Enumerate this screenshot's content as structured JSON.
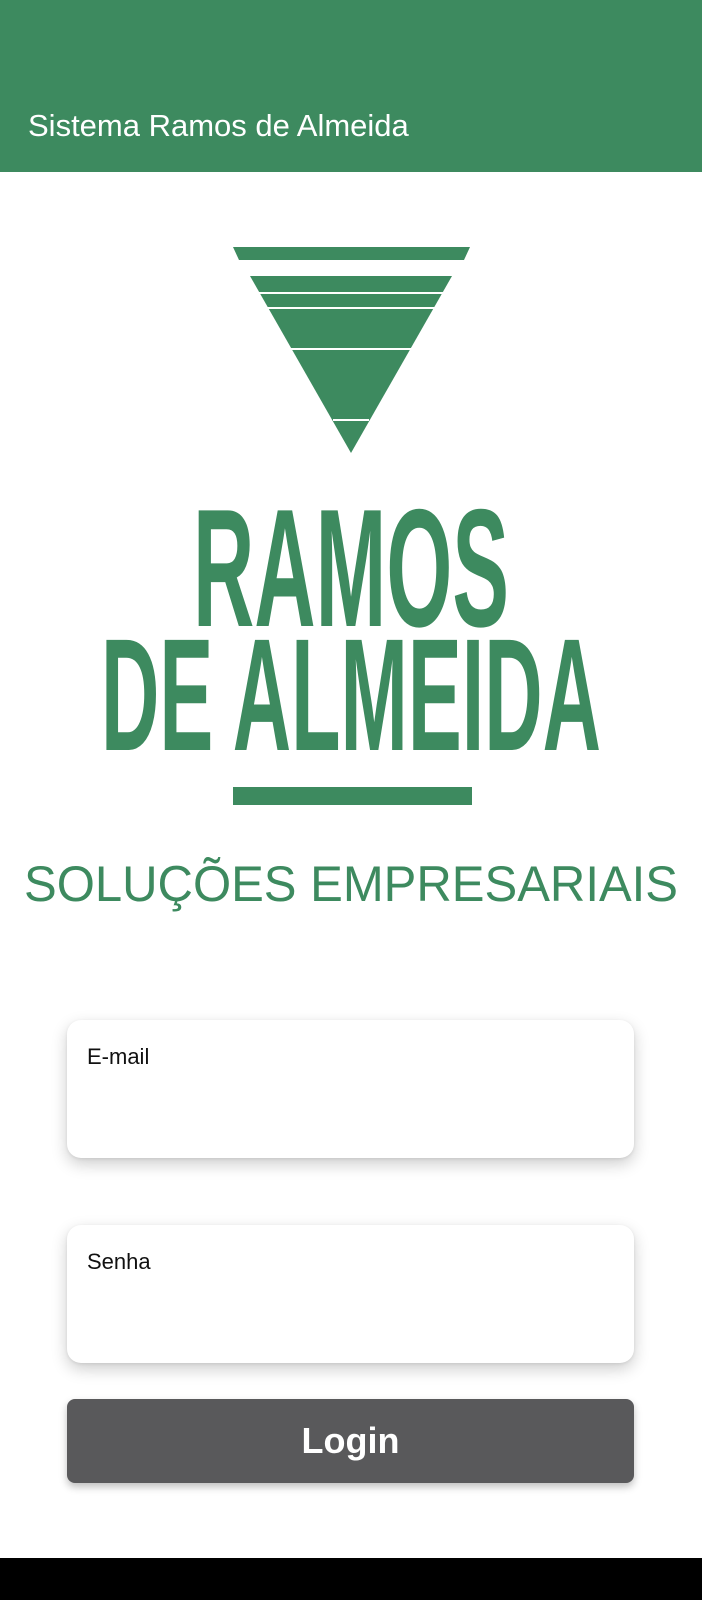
{
  "app_bar": {
    "title": "Sistema Ramos de Almeida",
    "color": "#3d8a5f"
  },
  "logo": {
    "line1": "RAMOS",
    "line2": "DE ALMEIDA",
    "tagline": "SOLUÇÕES EMPRESARIAIS",
    "color": "#3d8a5f"
  },
  "form": {
    "email": {
      "label": "E-mail",
      "value": ""
    },
    "senha": {
      "label": "Senha",
      "value": ""
    },
    "login_label": "Login",
    "button_color": "#59595b"
  }
}
